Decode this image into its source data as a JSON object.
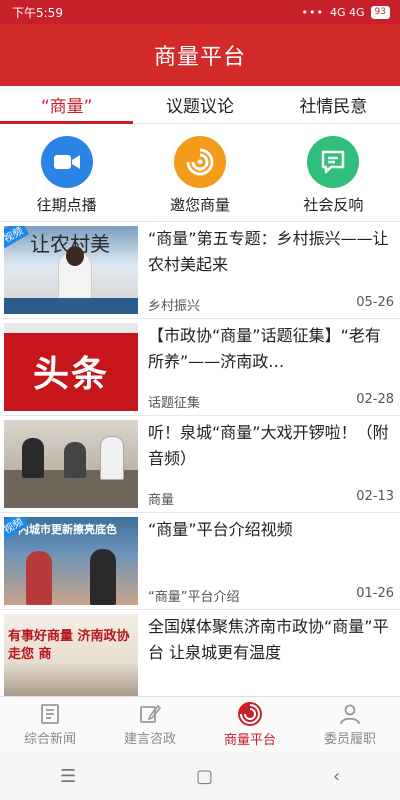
{
  "status": {
    "time": "下午5:59",
    "signal_text": "4G 4G",
    "battery": "93"
  },
  "app": {
    "title": "商量平台"
  },
  "tabs": [
    {
      "label": "“商量”"
    },
    {
      "label": "议题议论"
    },
    {
      "label": "社情民意"
    }
  ],
  "quick_actions": [
    {
      "label": "往期点播",
      "icon": "video-camera-icon",
      "color": "#2a84e6"
    },
    {
      "label": "邀您商量",
      "icon": "swirl-icon",
      "color": "#f59b1a"
    },
    {
      "label": "社会反响",
      "icon": "chat-bubble-icon",
      "color": "#2fbf7b"
    }
  ],
  "articles": [
    {
      "title": "“商量”第五专题：乡村振兴——让农村美起来",
      "category": "乡村振兴",
      "date": "05-26",
      "tag": "视频",
      "thumb_text": "让农村美"
    },
    {
      "title": "【市政协“商量”话题征集】“老有所养”——济南政…",
      "category": "话题征集",
      "date": "02-28",
      "tag": "",
      "thumb_text": "头条"
    },
    {
      "title": "听！泉城“商量”大戏开锣啦！（附音频）",
      "category": "商量",
      "date": "02-13",
      "tag": "",
      "thumb_text": ""
    },
    {
      "title": "“商量”平台介绍视频",
      "category": "“商量”平台介绍",
      "date": "01-26",
      "tag": "视频",
      "thumb_text": "内城市更新擦亮底色"
    },
    {
      "title": "全国媒体聚焦济南市政协“商量”平台 让泉城更有温度",
      "category": "",
      "date": "",
      "tag": "",
      "thumb_text": "有事好商量 济南政协走您 商"
    }
  ],
  "bottom_nav": [
    {
      "label": "综合新闻"
    },
    {
      "label": "建言咨政"
    },
    {
      "label": "商量平台"
    },
    {
      "label": "委员履职"
    }
  ],
  "system_nav": {
    "menu": "☰",
    "home": "▢",
    "back": "‹"
  }
}
